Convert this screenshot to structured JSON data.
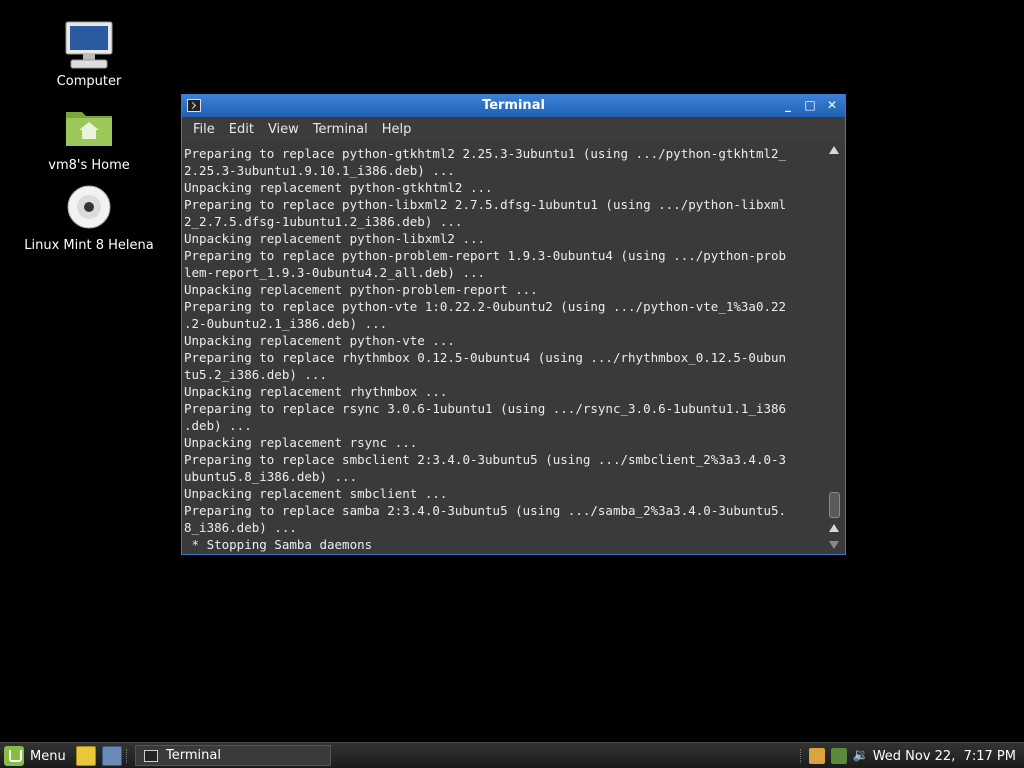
{
  "desktop": {
    "icons": [
      {
        "label": "Computer",
        "icon": "computer-icon"
      },
      {
        "label": "vm8's Home",
        "icon": "home-folder-icon"
      },
      {
        "label": "Linux Mint 8 Helena",
        "icon": "cd-disc-icon"
      }
    ]
  },
  "window": {
    "title": "Terminal",
    "controls": {
      "minimize": "_",
      "maximize": "□",
      "close": "✕"
    },
    "menu": [
      {
        "label": "File"
      },
      {
        "label": "Edit"
      },
      {
        "label": "View"
      },
      {
        "label": "Terminal"
      },
      {
        "label": "Help"
      }
    ],
    "terminal_lines": [
      "Preparing to replace python-gtkhtml2 2.25.3-3ubuntu1 (using .../python-gtkhtml2_",
      "2.25.3-3ubuntu1.9.10.1_i386.deb) ...",
      "Unpacking replacement python-gtkhtml2 ...",
      "Preparing to replace python-libxml2 2.7.5.dfsg-1ubuntu1 (using .../python-libxml",
      "2_2.7.5.dfsg-1ubuntu1.2_i386.deb) ...",
      "Unpacking replacement python-libxml2 ...",
      "Preparing to replace python-problem-report 1.9.3-0ubuntu4 (using .../python-prob",
      "lem-report_1.9.3-0ubuntu4.2_all.deb) ...",
      "Unpacking replacement python-problem-report ...",
      "Preparing to replace python-vte 1:0.22.2-0ubuntu2 (using .../python-vte_1%3a0.22",
      ".2-0ubuntu2.1_i386.deb) ...",
      "Unpacking replacement python-vte ...",
      "Preparing to replace rhythmbox 0.12.5-0ubuntu4 (using .../rhythmbox_0.12.5-0ubun",
      "tu5.2_i386.deb) ...",
      "Unpacking replacement rhythmbox ...",
      "Preparing to replace rsync 3.0.6-1ubuntu1 (using .../rsync_3.0.6-1ubuntu1.1_i386",
      ".deb) ...",
      "Unpacking replacement rsync ...",
      "Preparing to replace smbclient 2:3.4.0-3ubuntu5 (using .../smbclient_2%3a3.4.0-3",
      "ubuntu5.8_i386.deb) ...",
      "Unpacking replacement smbclient ...",
      "Preparing to replace samba 2:3.4.0-3ubuntu5 (using .../samba_2%3a3.4.0-3ubuntu5.",
      "8_i386.deb) ...",
      " * Stopping Samba daemons"
    ]
  },
  "taskbar": {
    "menu_label": "Menu",
    "task_label": "Terminal",
    "clock": "Wed Nov 22,  7:17 PM"
  }
}
